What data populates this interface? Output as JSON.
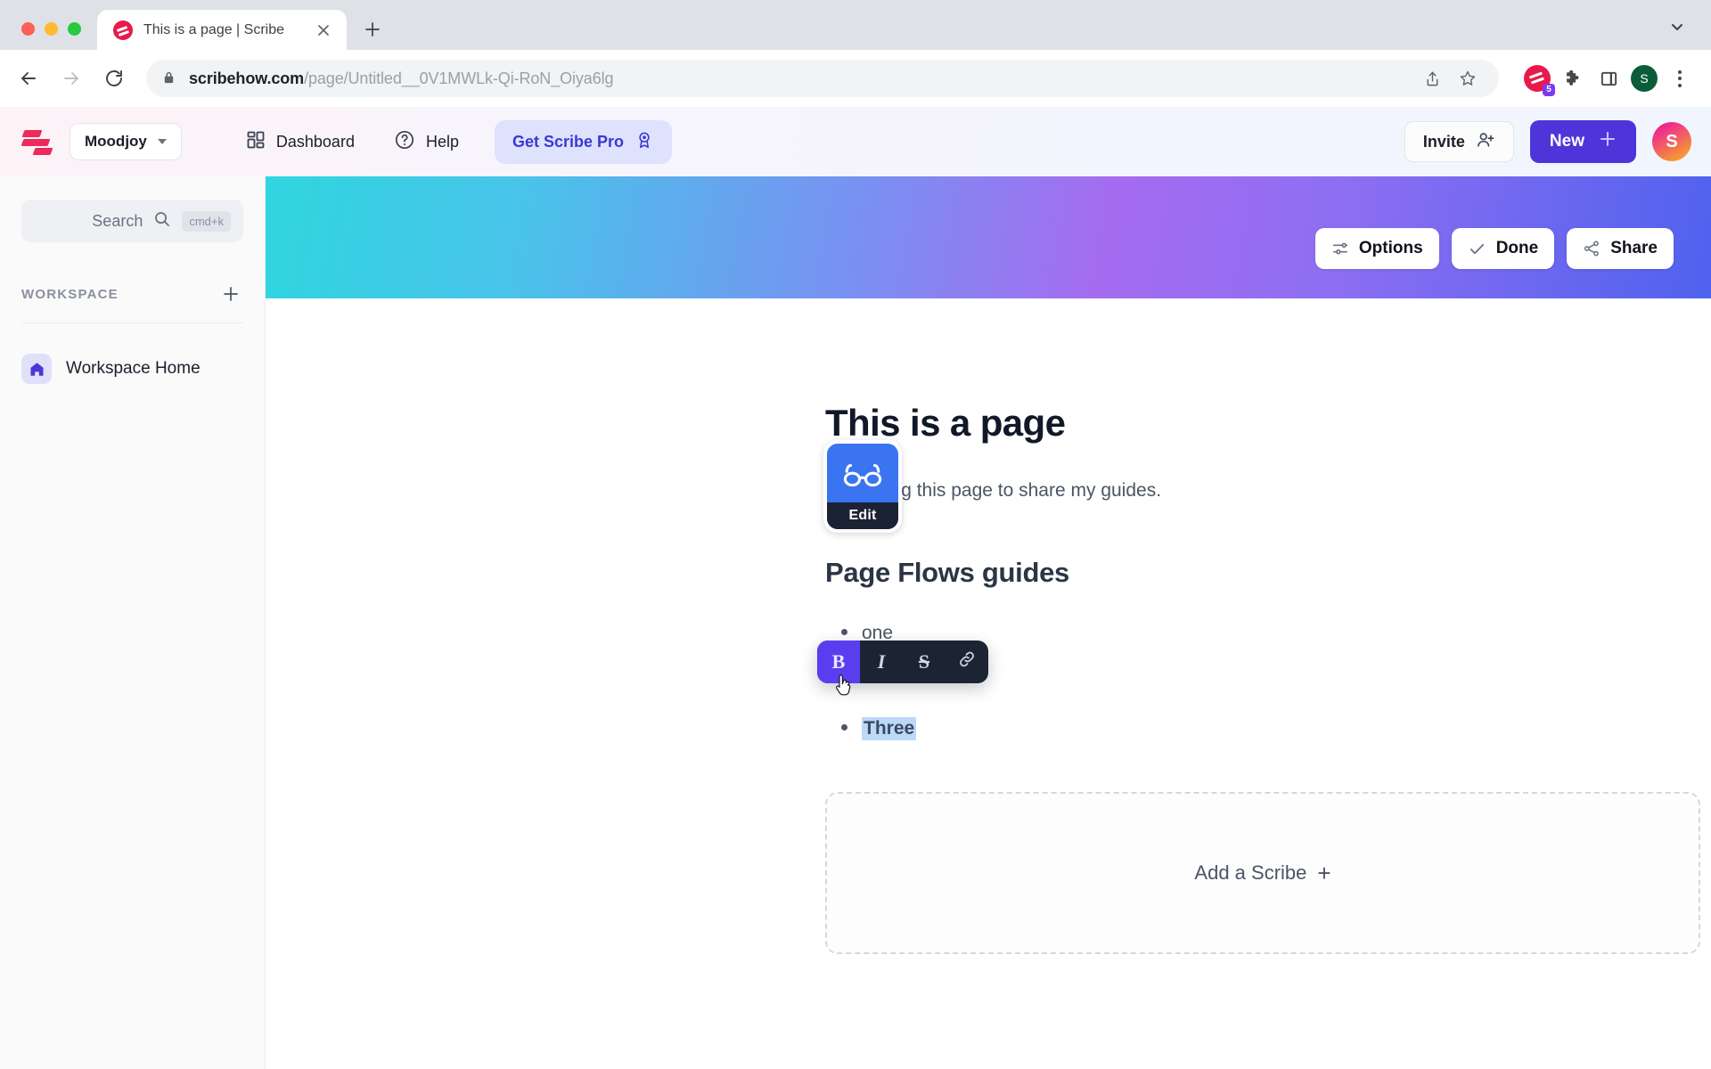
{
  "browser": {
    "tab": {
      "title": "This is a page | Scribe",
      "favicon_icon": "scribe-favicon",
      "close_icon": "close-icon"
    },
    "new_tab_icon": "plus-icon",
    "tab_list_icon": "chevron-down-icon",
    "nav": {
      "back_icon": "arrow-left-icon",
      "forward_icon": "arrow-right-icon",
      "reload_icon": "reload-icon"
    },
    "omnibox": {
      "lock_icon": "lock-icon",
      "url_host": "scribehow.com",
      "url_path": "/page/Untitled__0V1MWLk-Qi-RoN_Oiya6lg",
      "share_icon": "share-upload-icon",
      "bookmark_icon": "star-icon"
    },
    "extensions": {
      "scribe_icon": "scribe-extension-icon",
      "scribe_badge": "5",
      "puzzle_icon": "puzzle-piece-icon",
      "sidepanel_icon": "side-panel-icon"
    },
    "profile_initial": "S",
    "menu_icon": "kebab-menu-icon"
  },
  "header": {
    "logo_icon": "scribe-logo",
    "workspace": {
      "name": "Moodjoy",
      "caret_icon": "chevron-down-icon"
    },
    "nav": [
      {
        "label": "Dashboard",
        "icon": "dashboard-grid-icon"
      },
      {
        "label": "Help",
        "icon": "question-circle-icon"
      }
    ],
    "pro": {
      "label": "Get Scribe Pro",
      "icon": "award-ribbon-icon",
      "bg": "#dfe2fd",
      "fg": "#3b37d6"
    },
    "invite": {
      "label": "Invite",
      "icon": "user-plus-icon"
    },
    "new": {
      "label": "New",
      "icon": "plus-icon",
      "bg": "#4f35d9"
    },
    "avatar_initial": "S"
  },
  "sidebar": {
    "search": {
      "label": "Search",
      "icon": "search-icon",
      "shortcut": "cmd+k"
    },
    "section": {
      "label": "WORKSPACE",
      "add_icon": "plus-icon"
    },
    "items": [
      {
        "label": "Workspace Home",
        "icon": "home-icon"
      }
    ]
  },
  "banner": {
    "gradient_from": "#2fd6df",
    "gradient_mid": "#a56cf0",
    "gradient_to": "#4f62ee",
    "actions": [
      {
        "label": "Options",
        "icon": "sliders-icon"
      },
      {
        "label": "Done",
        "icon": "check-icon"
      },
      {
        "label": "Share",
        "icon": "share-nodes-icon"
      }
    ]
  },
  "page": {
    "icon": {
      "glyph": "glasses-icon",
      "bg": "#3b74f0",
      "edit_label": "Edit"
    },
    "title": "This is a page",
    "subtitle": "I am using this page to share my guides.",
    "heading": "Page Flows guides",
    "list": [
      {
        "text": "one"
      },
      {
        "text": "Three",
        "bold": true,
        "selected": true
      }
    ],
    "format_toolbar": {
      "buttons": [
        {
          "name": "bold",
          "label": "B",
          "active": true
        },
        {
          "name": "italic",
          "label": "I",
          "active": false
        },
        {
          "name": "strikethrough",
          "label": "S",
          "active": false
        },
        {
          "name": "link",
          "label": "",
          "icon": "link-icon",
          "active": false
        }
      ],
      "active_bg": "#5b3df0",
      "bg": "#1c2434"
    },
    "add_scribe": {
      "label": "Add a Scribe",
      "plus": "+"
    }
  }
}
